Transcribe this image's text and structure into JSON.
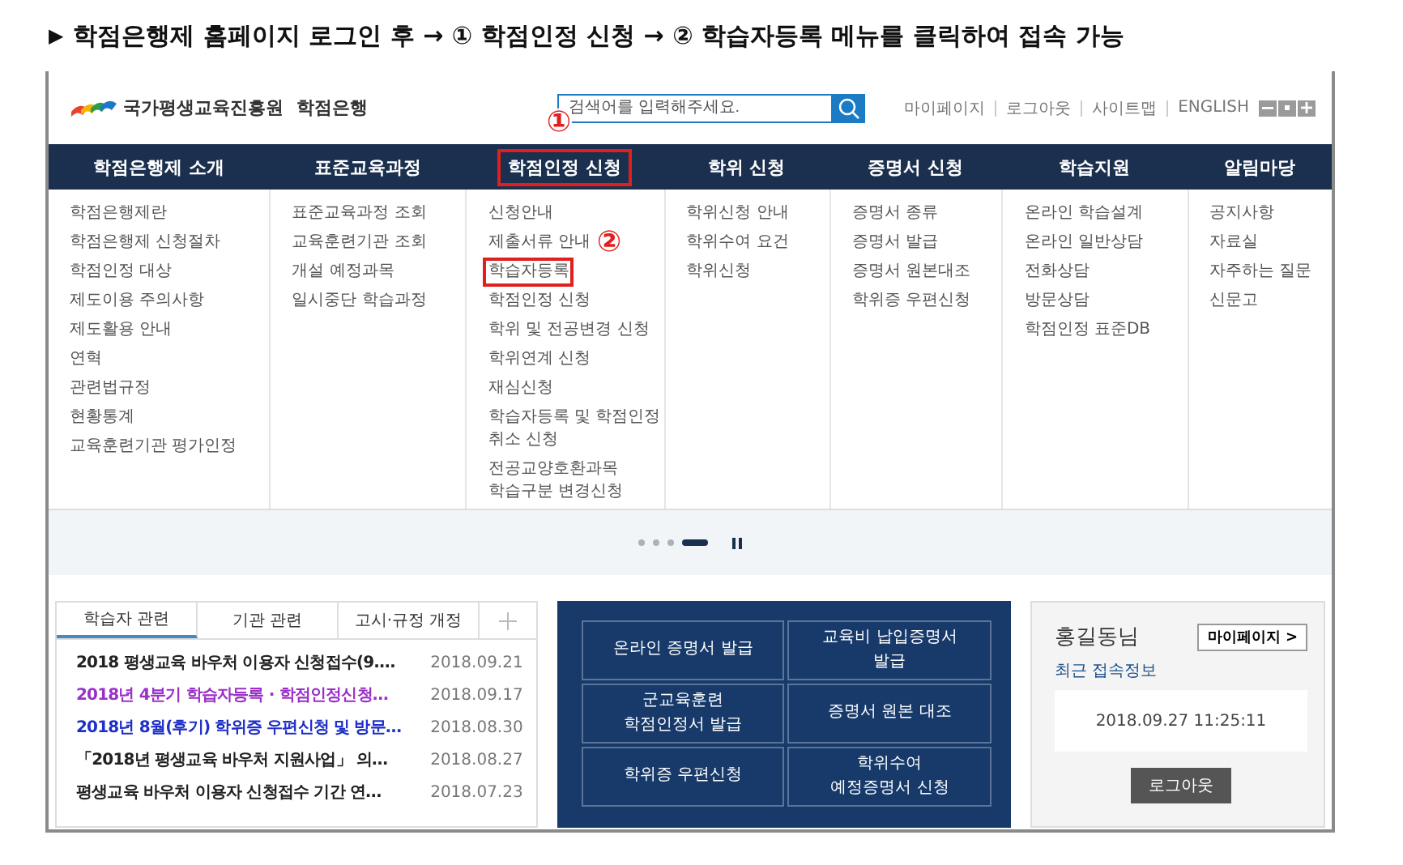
{
  "caption": {
    "arrow": "▶",
    "text": "학점은행제 홈페이지 로그인 후 → ① 학점인정 신청 → ② 학습자등록 메뉴를 클릭하여 접속 가능"
  },
  "header": {
    "org_name": "국가평생교육진흥원",
    "site_name": "학점은행",
    "search": {
      "placeholder": "검색어를 입력해주세요."
    },
    "util_links": [
      "마이페이지",
      "로그아웃",
      "사이트맵",
      "ENGLISH"
    ]
  },
  "nav": [
    {
      "label": "학점은행제 소개",
      "highlighted": false,
      "items": [
        {
          "label": "학점은행제란",
          "highlighted": false
        },
        {
          "label": "학점은행제 신청절차",
          "highlighted": false
        },
        {
          "label": "학점인정 대상",
          "highlighted": false
        },
        {
          "label": "제도이용 주의사항",
          "highlighted": false
        },
        {
          "label": "제도활용 안내",
          "highlighted": false
        },
        {
          "label": "연혁",
          "highlighted": false
        },
        {
          "label": "관련법규정",
          "highlighted": false
        },
        {
          "label": "현황통계",
          "highlighted": false
        },
        {
          "label": "교육훈련기관 평가인정",
          "highlighted": false
        }
      ]
    },
    {
      "label": "표준교육과정",
      "highlighted": false,
      "items": [
        {
          "label": "표준교육과정 조회",
          "highlighted": false
        },
        {
          "label": "교육훈련기관 조회",
          "highlighted": false
        },
        {
          "label": "개설 예정과목",
          "highlighted": false
        },
        {
          "label": "일시중단 학습과정",
          "highlighted": false
        }
      ]
    },
    {
      "label": "학점인정 신청",
      "highlighted": true,
      "marker": "①",
      "items": [
        {
          "label": "신청안내",
          "highlighted": false
        },
        {
          "label": "제출서류 안내",
          "highlighted": false,
          "marker": "②"
        },
        {
          "label": "학습자등록",
          "highlighted": true
        },
        {
          "label": "학점인정 신청",
          "highlighted": false
        },
        {
          "label": "학위 및 전공변경 신청",
          "highlighted": false
        },
        {
          "label": "학위연계 신청",
          "highlighted": false
        },
        {
          "label": "재심신청",
          "highlighted": false
        },
        {
          "label": "학습자등록 및 학점인정\n취소 신청",
          "highlighted": false
        },
        {
          "label": "전공교양호환과목\n학습구분 변경신청",
          "highlighted": false
        }
      ]
    },
    {
      "label": "학위 신청",
      "highlighted": false,
      "items": [
        {
          "label": "학위신청 안내",
          "highlighted": false
        },
        {
          "label": "학위수여 요건",
          "highlighted": false
        },
        {
          "label": "학위신청",
          "highlighted": false
        }
      ]
    },
    {
      "label": "증명서 신청",
      "highlighted": false,
      "items": [
        {
          "label": "증명서 종류",
          "highlighted": false
        },
        {
          "label": "증명서 발급",
          "highlighted": false
        },
        {
          "label": "증명서 원본대조",
          "highlighted": false
        },
        {
          "label": "학위증 우편신청",
          "highlighted": false
        }
      ]
    },
    {
      "label": "학습지원",
      "highlighted": false,
      "items": [
        {
          "label": "온라인 학습설계",
          "highlighted": false
        },
        {
          "label": "온라인 일반상담",
          "highlighted": false
        },
        {
          "label": "전화상담",
          "highlighted": false
        },
        {
          "label": "방문상담",
          "highlighted": false
        },
        {
          "label": "학점인정 표준DB",
          "highlighted": false
        }
      ]
    },
    {
      "label": "알림마당",
      "highlighted": false,
      "items": [
        {
          "label": "공지사항",
          "highlighted": false
        },
        {
          "label": "자료실",
          "highlighted": false
        },
        {
          "label": "자주하는 질문",
          "highlighted": false
        },
        {
          "label": "신문고",
          "highlighted": false
        }
      ]
    }
  ],
  "slides": [
    {
      "selected": false
    },
    {
      "selected": false
    },
    {
      "selected": false
    },
    {
      "selected": true
    }
  ],
  "notices": {
    "tabs": [
      {
        "label": "학습자 관련",
        "selected": true
      },
      {
        "label": "기관 관련",
        "selected": false
      },
      {
        "label": "고시·규정 개정",
        "selected": false
      }
    ],
    "items": [
      {
        "title": "2018 평생교육 바우처 이용자 신청접수(9.…",
        "date": "2018.09.21",
        "color": "#222222"
      },
      {
        "title": "2018년 4분기 학습자등록 · 학점인정신청…",
        "date": "2018.09.17",
        "color": "#9b30c8"
      },
      {
        "title": "2018년 8월(후기) 학위증 우편신청 및 방문…",
        "date": "2018.08.30",
        "color": "#1f2fc8"
      },
      {
        "title": "「2018년 평생교육 바우처 지원사업」 의…",
        "date": "2018.08.27",
        "color": "#222222"
      },
      {
        "title": "평생교육 바우처 이용자 신청접수 기간 연…",
        "date": "2018.07.23",
        "color": "#222222"
      }
    ]
  },
  "quick_links": [
    "온라인 증명서 발급",
    "교육비 납입증명서\n발급",
    "군교육훈련\n학점인정서 발급",
    "증명서 원본 대조",
    "학위증 우편신청",
    "학위수여\n예정증명서 신청"
  ],
  "user": {
    "name": "홍길동님",
    "mypage_button": "마이페이지 >",
    "recent_label": "최근 접속정보",
    "last_login": "2018.09.27 11:25:11",
    "logout_button": "로그아웃"
  }
}
